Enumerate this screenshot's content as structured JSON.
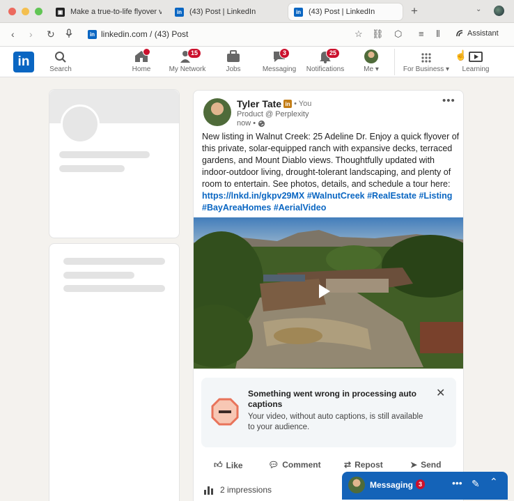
{
  "browser": {
    "tabs": [
      {
        "title": "Make a true-to-life flyover vi",
        "favicon": "ai-app-icon",
        "active": false
      },
      {
        "title": "(43) Post | LinkedIn",
        "favicon": "linkedin-icon",
        "active": false
      },
      {
        "title": "(43) Post | LinkedIn",
        "favicon": "linkedin-icon",
        "active": true
      }
    ],
    "url": "linkedin.com / (43) Post",
    "assistant_label": "Assistant"
  },
  "linkedin_nav": {
    "logo": "in",
    "search_label": "Search",
    "items": [
      {
        "label": "Home",
        "badge": "",
        "icon": "home-icon"
      },
      {
        "label": "My Network",
        "badge": "15",
        "icon": "network-icon"
      },
      {
        "label": "Jobs",
        "badge": "",
        "icon": "briefcase-icon"
      },
      {
        "label": "Messaging",
        "badge": "3",
        "icon": "chat-icon"
      },
      {
        "label": "Notifications",
        "badge": "25",
        "icon": "bell-icon"
      },
      {
        "label": "Me",
        "badge": "",
        "icon": "avatar"
      },
      {
        "label": "For Business",
        "badge": "",
        "icon": "grid-icon"
      },
      {
        "label": "Learning",
        "badge": "",
        "icon": "learning-icon"
      }
    ]
  },
  "post": {
    "author": {
      "name": "Tyler Tate",
      "badge": "in",
      "you": "• You",
      "title": "Product @ Perplexity",
      "time": "now •"
    },
    "body": "New listing in Walnut Creek: 25 Adeline Dr. Enjoy a quick flyover of this private, solar-equipped ranch with expansive decks, terraced gardens, and Mount Diablo views. Thoughtfully updated with indoor-outdoor living, drought-tolerant landscaping, and plenty of room to entertain. See photos, details, and schedule a tour here:",
    "link": "https://lnkd.in/gkpv29MX",
    "hashtags_line1": "#WalnutCreek #RealEstate",
    "hashtags_line2": "#Listing #BayAreaHomes #AerialVideo",
    "alert": {
      "title": "Something went wrong in processing auto captions",
      "message": "Your video, without auto captions, is still available to your audience."
    },
    "actions": {
      "like": "Like",
      "comment": "Comment",
      "repost": "Repost",
      "send": "Send"
    },
    "impressions": "2 impressions"
  },
  "messaging": {
    "title": "Messaging",
    "badge": "3"
  },
  "colors": {
    "linkedin_blue": "#0a66c2",
    "badge_red": "#cb112d",
    "alert_icon": "#e8735a"
  }
}
